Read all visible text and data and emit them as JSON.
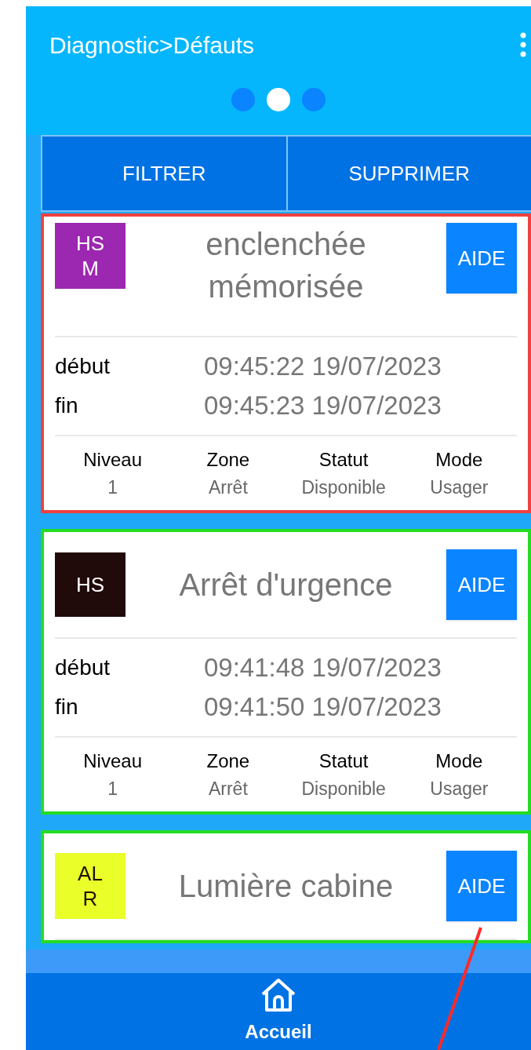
{
  "header": {
    "title": "Diagnostic>Défauts"
  },
  "pager": [
    {
      "selected": false
    },
    {
      "selected": true
    },
    {
      "selected": false
    }
  ],
  "actions": [
    "FILTRER",
    "SUPPRIMER"
  ],
  "faults": [
    {
      "color": "#f04040",
      "badge": {
        "lines": [
          "HS",
          "M"
        ],
        "color": "#9c27b0"
      },
      "title_lines": [
        "enclenchée",
        "mémorisée"
      ],
      "help": "AIDE",
      "times": [
        {
          "label": "début",
          "value": "09:45:22 19/07/2023"
        },
        {
          "label": "fin",
          "value": "09:45:23 19/07/2023"
        }
      ],
      "details": [
        {
          "label": "Niveau",
          "value": "1"
        },
        {
          "label": "Zone",
          "value": "Arrêt"
        },
        {
          "label": "Statut",
          "value": "Disponible"
        },
        {
          "label": "Mode",
          "value": "Usager"
        }
      ]
    },
    {
      "color": "#22dd22",
      "badge": {
        "lines": [
          "HS"
        ],
        "color": "#210a0a"
      },
      "title_lines": [
        "Arrêt d'urgence"
      ],
      "help": "AIDE",
      "times": [
        {
          "label": "début",
          "value": "09:41:48 19/07/2023"
        },
        {
          "label": "fin",
          "value": "09:41:50 19/07/2023"
        }
      ],
      "details": [
        {
          "label": "Niveau",
          "value": "1"
        },
        {
          "label": "Zone",
          "value": "Arrêt"
        },
        {
          "label": "Statut",
          "value": "Disponible"
        },
        {
          "label": "Mode",
          "value": "Usager"
        }
      ]
    },
    {
      "color": "#22dd22",
      "badge": {
        "lines": [
          "AL",
          "R"
        ],
        "color": "#eaff2a"
      },
      "title_lines": [
        "Lumière cabine"
      ],
      "help": "AIDE"
    }
  ],
  "bottom_nav": {
    "label": "Accueil"
  }
}
